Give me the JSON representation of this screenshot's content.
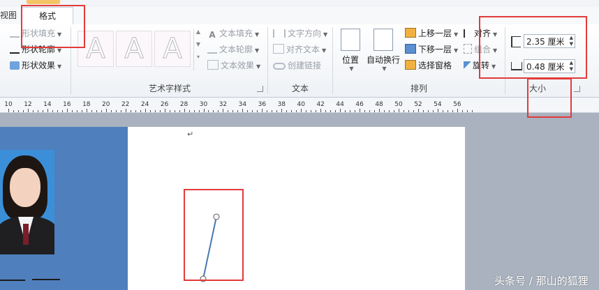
{
  "tabs": {
    "view": "视图",
    "format": "格式"
  },
  "shape_styles": {
    "fill": "形状填充",
    "outline": "形状轮廓",
    "effects": "形状效果"
  },
  "wordart": {
    "label": "艺术字样式",
    "sample": "A",
    "text_fill": "文本填充",
    "text_outline": "文本轮廓",
    "text_effects": "文本效果"
  },
  "text_group": {
    "label": "文本",
    "direction": "文字方向",
    "align_text": "对齐文本",
    "create_link": "创建链接"
  },
  "arrange": {
    "label": "排列",
    "position": "位置",
    "wrap_text": "自动换行",
    "bring_forward": "上移一层",
    "send_backward": "下移一层",
    "selection_pane": "选择窗格",
    "align": "对齐",
    "group": "组合",
    "rotate": "旋转"
  },
  "size": {
    "label": "大小",
    "height": "2.35 厘米",
    "width": "0.48 厘米"
  },
  "ruler": {
    "ticks": [
      "10",
      "12",
      "14",
      "16",
      "18",
      "20",
      "22",
      "24",
      "26",
      "28",
      "30",
      "32",
      "34",
      "36",
      "38",
      "40",
      "42",
      "44",
      "46",
      "48",
      "50",
      "52",
      "54",
      "56"
    ]
  },
  "document": {
    "paragraph_mark": "↵"
  },
  "watermark": "头条号 / 那山的狐狸",
  "colors": {
    "highlight": "#e23b3b",
    "ribbon_bg": "#ffffff",
    "page_blue": "#4f7fbd"
  }
}
